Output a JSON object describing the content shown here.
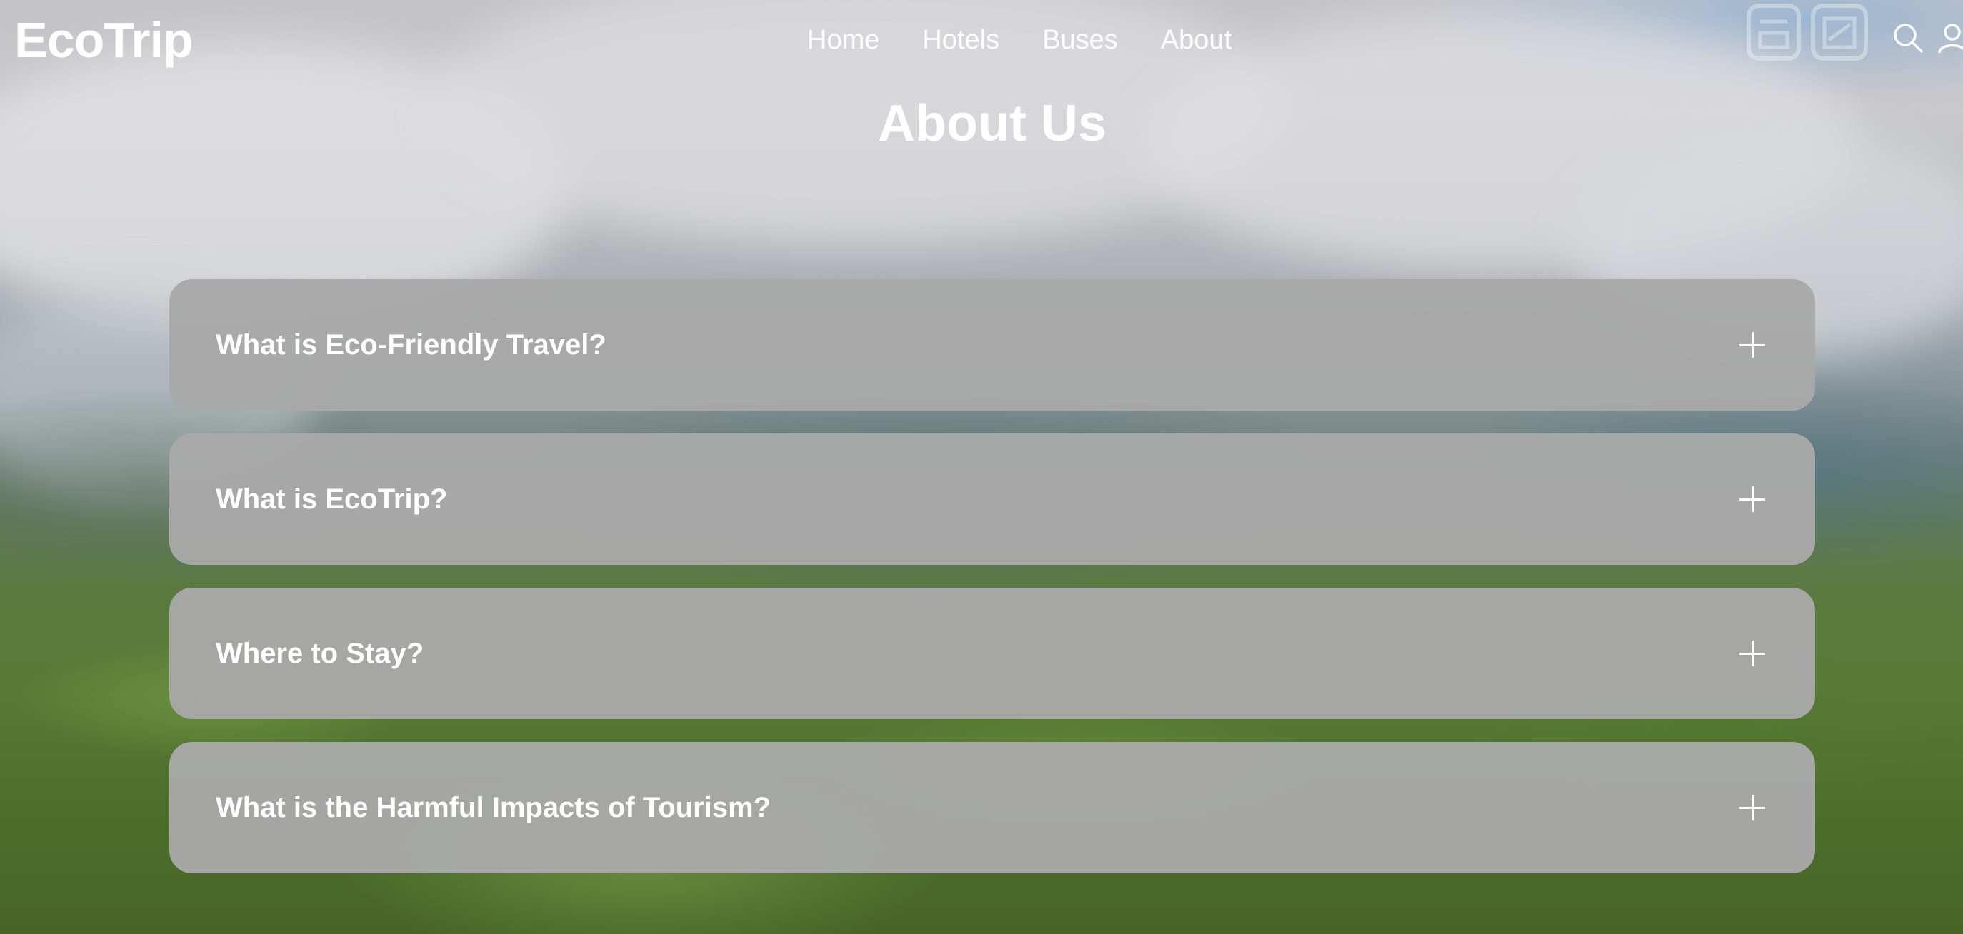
{
  "brand": {
    "logo": "EcoTrip"
  },
  "nav": {
    "items": [
      {
        "label": "Home"
      },
      {
        "label": "Hotels"
      },
      {
        "label": "Buses"
      },
      {
        "label": "About"
      }
    ]
  },
  "header_icons": [
    "search-icon",
    "user-icon"
  ],
  "page": {
    "title": "About Us"
  },
  "faq": {
    "items": [
      {
        "question": "What is Eco-Friendly Travel?",
        "state": "collapsed"
      },
      {
        "question": "What is EcoTrip?",
        "state": "collapsed"
      },
      {
        "question": "Where to Stay?",
        "state": "collapsed"
      },
      {
        "question": "What is the Harmful Impacts of Tourism?",
        "state": "collapsed"
      }
    ]
  },
  "colors": {
    "text": "#ffffff",
    "card_bg": "#a8a8a8"
  }
}
